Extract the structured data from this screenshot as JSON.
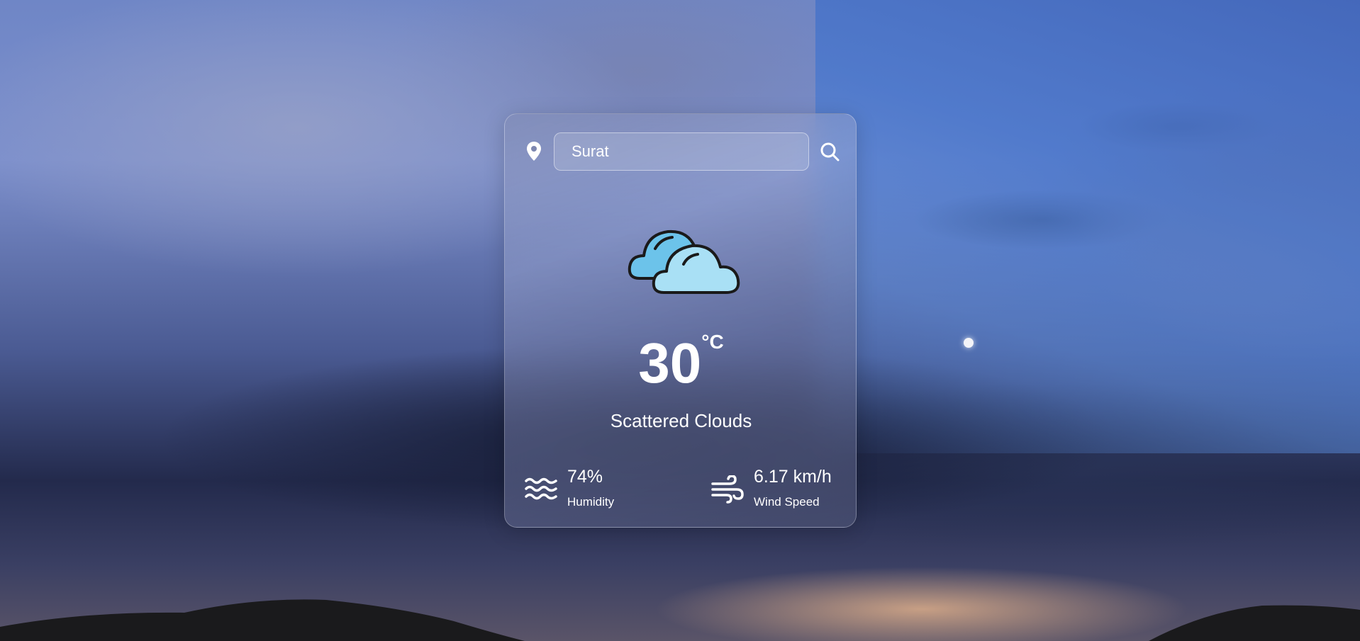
{
  "search": {
    "value": "Surat",
    "icon": "search-icon"
  },
  "location_icon": "location-pin-icon",
  "weather": {
    "icon": "scattered-clouds-icon",
    "temperature": "30",
    "unit": "°C",
    "description": "Scattered Clouds"
  },
  "humidity": {
    "icon": "humidity-waves-icon",
    "value": "74%",
    "label": "Humidity"
  },
  "wind": {
    "icon": "wind-icon",
    "value": "6.17 km/h",
    "label": "Wind Speed"
  },
  "colors": {
    "text": "#ffffff",
    "cloud_back": "#6cc3ea",
    "cloud_front": "#a9e0f5",
    "outline": "#1a1a1a"
  }
}
